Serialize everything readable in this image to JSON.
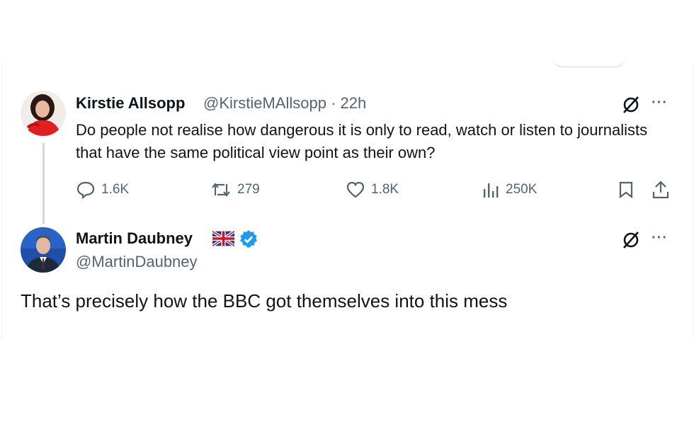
{
  "tweet": {
    "author_name": "Kirstie Allsopp",
    "author_handle": "@KirstieMAllsopp",
    "separator": "·",
    "time": "22h",
    "text": "Do people not realise how dangerous it is only to read, watch or listen to journalists that have the same political view point as their own?",
    "stats": {
      "replies": "1.6K",
      "reposts": "279",
      "likes": "1.8K",
      "views": "250K"
    }
  },
  "reply": {
    "author_name": "Martin Daubney",
    "author_handle": "@MartinDaubney",
    "verified": true,
    "flag": "uk-flag",
    "text": "That’s precisely how the BBC got themselves into this mess"
  },
  "colors": {
    "text": "#0f1419",
    "secondary": "#536471",
    "verified": "#1d9bf0",
    "thread_line": "#cfd9de"
  },
  "icons": [
    "grok-icon",
    "more-icon",
    "reply-icon",
    "repost-icon",
    "like-icon",
    "views-icon",
    "bookmark-icon",
    "share-icon",
    "verified-badge-icon"
  ]
}
